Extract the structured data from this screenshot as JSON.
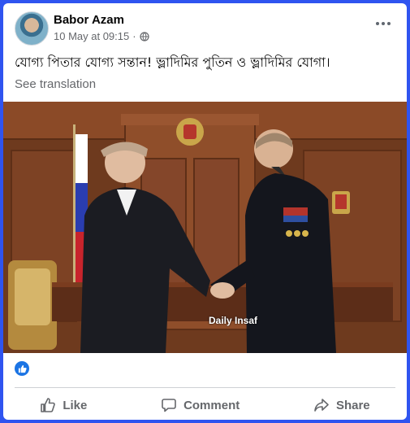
{
  "post": {
    "author": "Babor Azam",
    "timestamp": "10 May at 09:15",
    "separator": "·",
    "text": "যোগ্য পিতার যোগ্য সন্তান! ভ্লাদিমির পুতিন ও ভ্লাদিমির যোগা।",
    "see_translation": "See translation",
    "photo_watermark": "Daily Insaf"
  },
  "actions": {
    "like": "Like",
    "comment": "Comment",
    "share": "Share"
  },
  "colors": {
    "frame_border": "#2f54f0",
    "fb_blue": "#1b74e4",
    "secondary_text": "#65676b"
  },
  "icons": [
    "globe-icon",
    "more-options-icon",
    "like-reaction-icon",
    "thumbs-up-icon",
    "comment-icon",
    "share-icon"
  ]
}
